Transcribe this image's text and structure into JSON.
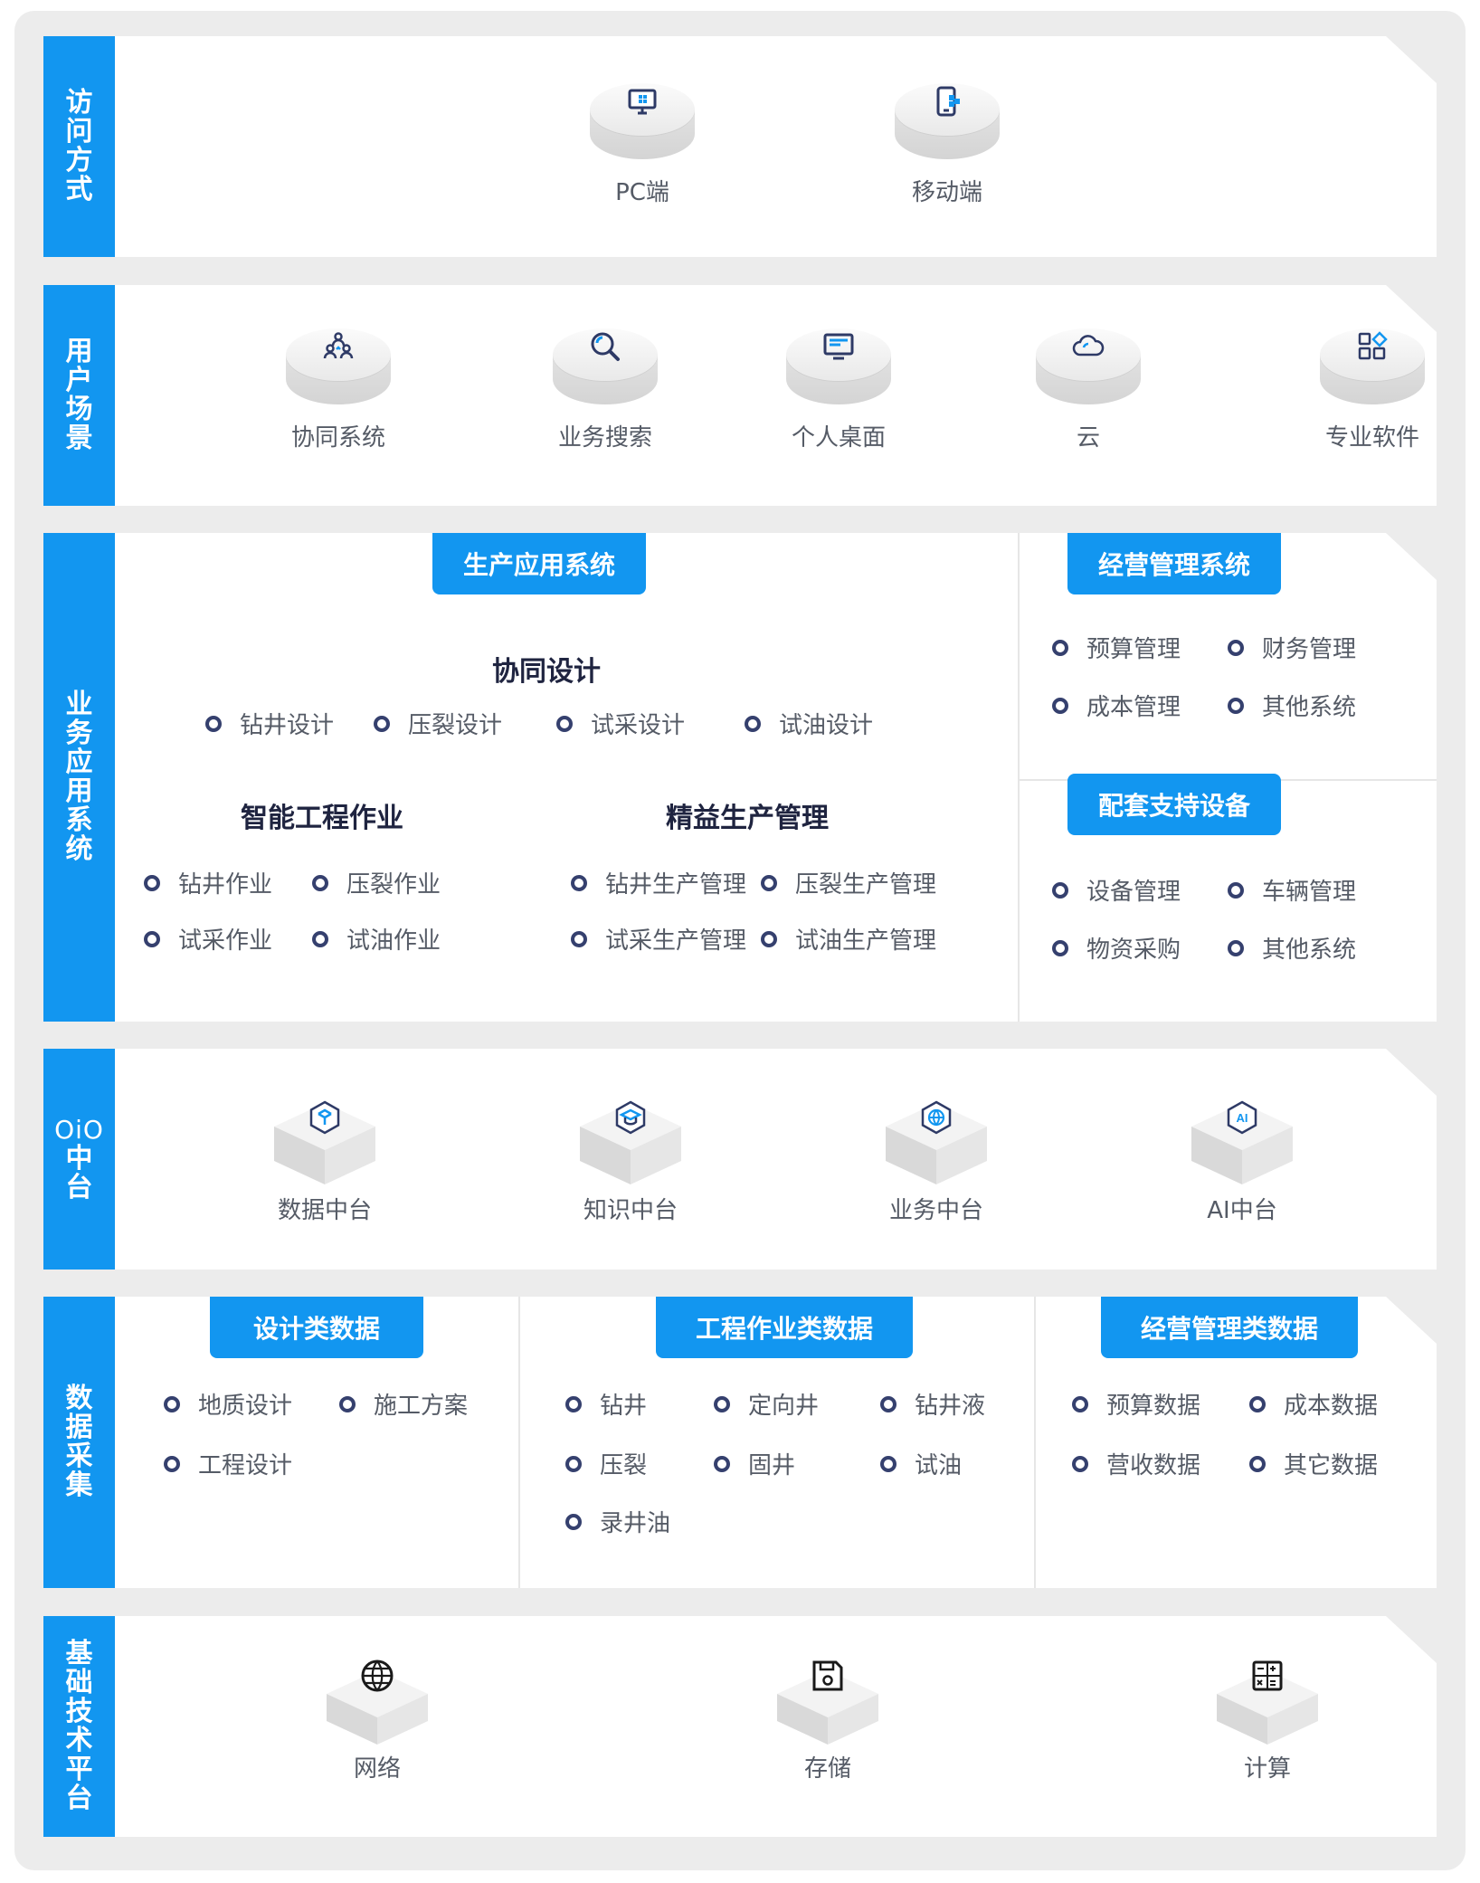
{
  "access": {
    "label_chars": [
      "访",
      "问",
      "方",
      "式"
    ],
    "items": [
      {
        "label": "PC端",
        "icon": "monitor-icon"
      },
      {
        "label": "移动端",
        "icon": "mobile-icon"
      }
    ]
  },
  "scenario": {
    "label_chars": [
      "用",
      "户",
      "场",
      "景"
    ],
    "items": [
      {
        "label": "协同系统",
        "icon": "people-icon"
      },
      {
        "label": "业务搜索",
        "icon": "search-icon"
      },
      {
        "label": "个人桌面",
        "icon": "desktop-icon"
      },
      {
        "label": "云",
        "icon": "cloud-icon"
      },
      {
        "label": "专业软件",
        "icon": "apps-icon"
      }
    ]
  },
  "business": {
    "label_chars": [
      "业",
      "务",
      "应",
      "用",
      "系",
      "统"
    ],
    "production": {
      "title": "生产应用系统",
      "collab": {
        "heading": "协同设计",
        "items": [
          "钻井设计",
          "压裂设计",
          "试采设计",
          "试油设计"
        ]
      },
      "smart": {
        "heading": "智能工程作业",
        "items": [
          "钻井作业",
          "压裂作业",
          "试采作业",
          "试油作业"
        ]
      },
      "lean": {
        "heading": "精益生产管理",
        "items": [
          "钻井生产管理",
          "压裂生产管理",
          "试采生产管理",
          "试油生产管理"
        ]
      }
    },
    "management": {
      "title": "经营管理系统",
      "items": [
        "预算管理",
        "财务管理",
        "成本管理",
        "其他系统"
      ]
    },
    "support": {
      "title": "配套支持设备",
      "items": [
        "设备管理",
        "车辆管理",
        "物资采购",
        "其他系统"
      ]
    }
  },
  "middle": {
    "label_latin": "OiO",
    "label_chars": [
      "中",
      "台"
    ],
    "items": [
      {
        "label": "数据中台",
        "icon": "data-cube-icon"
      },
      {
        "label": "知识中台",
        "icon": "knowledge-icon"
      },
      {
        "label": "业务中台",
        "icon": "business-globe-icon"
      },
      {
        "label": "AI中台",
        "icon": "ai-icon",
        "icon_text": "AI"
      }
    ]
  },
  "collection": {
    "label_chars": [
      "数",
      "据",
      "采",
      "集"
    ],
    "design": {
      "title": "设计类数据",
      "items": [
        "地质设计",
        "施工方案",
        "工程设计"
      ]
    },
    "engineering": {
      "title": "工程作业类数据",
      "items": [
        "钻井",
        "定向井",
        "钻井液",
        "压裂",
        "固井",
        "试油",
        "录井油"
      ]
    },
    "operation": {
      "title": "经营管理类数据",
      "items": [
        "预算数据",
        "成本数据",
        "营收数据",
        "其它数据"
      ]
    }
  },
  "infra": {
    "label_chars": [
      "基",
      "础",
      "技",
      "术",
      "平",
      "台"
    ],
    "items": [
      {
        "label": "网络",
        "icon": "globe-icon"
      },
      {
        "label": "存储",
        "icon": "save-icon"
      },
      {
        "label": "计算",
        "icon": "calculator-icon"
      }
    ]
  },
  "colors": {
    "accent": "#1296f0",
    "bullet": "#35406e",
    "panel": "#ececec"
  }
}
